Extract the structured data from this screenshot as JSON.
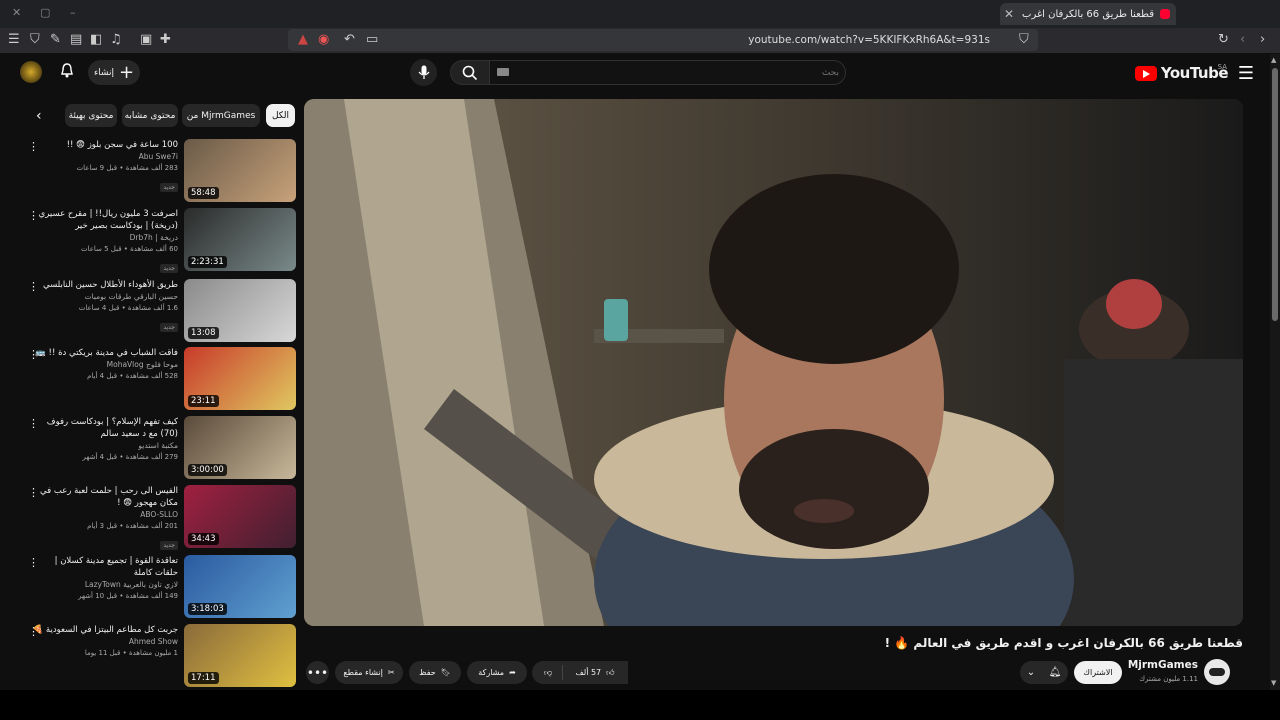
{
  "browser": {
    "tab_title": "قطعنا طريق 66 بالكرفان اغرب و",
    "url": "youtube.com/watch?v=5KKIFKxRh6A&t=931s"
  },
  "header": {
    "logo_text": "YouTube",
    "country_code": "SA",
    "search_placeholder": "بحث",
    "create_label": "إنشاء"
  },
  "chips": {
    "all": "الكل",
    "from": "من MjrmGames",
    "related": "محتوى مشابه",
    "fun": "محتوى بهيئة"
  },
  "video": {
    "title": "قطعنا طريق 66 بالكرفان اغرب و اقدم طريق في العالم 🔥 !",
    "channel": "MjrmGames",
    "subscribers": "1.11 مليون مشترك",
    "subscribe_label": "الاشتراك",
    "likes": "57 ألف",
    "share_label": "مشاركة",
    "save_label": "حفظ",
    "clip_label": "إنشاء مقطع"
  },
  "related": [
    {
      "title": "100 ساعة في سجن بلوز 😨 !!",
      "channel": "Abu Swe7i",
      "meta": "283 ألف مشاهدة • قبل 9 ساعات",
      "badge": "جديد",
      "duration": "58:48",
      "thumb": [
        "#6a5a48",
        "#c8a27a"
      ]
    },
    {
      "title": "اصرفت 3 مليون ريال!! | مقرح عسيري (دريخة) | بودكاست بصير خير",
      "channel": "دريخة | Drb7h",
      "meta": "60 ألف مشاهدة • قبل 5 ساعات",
      "badge": "جديد",
      "duration": "2:23:31",
      "thumb": [
        "#2a2a2a",
        "#7a8a8a"
      ]
    },
    {
      "title": "طريق الأهوداء الأطلال حسين النابلسي",
      "channel": "حسين البارقي طرقات بومبات",
      "meta": "1.6 ألف مشاهدة • قبل 4 ساعات",
      "badge": "جديد",
      "duration": "13:08",
      "thumb": [
        "#8a8a8a",
        "#d8d8d8"
      ]
    },
    {
      "title": "فاقت الشباب في مدينة بريكتي دة !! 🚌",
      "channel": "موحا فلوج MohaVlog",
      "meta": "528 ألف مشاهدة • قبل 4 أيام",
      "badge": "",
      "duration": "23:11",
      "thumb": [
        "#c83a2a",
        "#e0c860"
      ]
    },
    {
      "title": "كيف تفهم الإسلام؟ | بودكاست رفوف (70) مع د سعيد سالم",
      "channel": "مكتبة استديو",
      "meta": "279 ألف مشاهدة • قبل 4 أشهر",
      "badge": "",
      "duration": "3:00:00",
      "thumb": [
        "#5a4a3a",
        "#c8b89a"
      ]
    },
    {
      "title": "الفيس الى رحب | حلمت لعبة رعب في مكان مهجور 😨 !",
      "channel": "ABO-SLLO",
      "meta": "201 ألف مشاهدة • قبل 3 أيام",
      "badge": "جديد",
      "duration": "34:43",
      "thumb": [
        "#a02040",
        "#402030"
      ]
    },
    {
      "title": "تعاقدة القوة | تجميع مدينة كسلان | حلقات كاملة",
      "channel": "لازي تاون بالعربية LazyTown",
      "meta": "149 ألف مشاهدة • قبل 10 أشهر",
      "badge": "",
      "duration": "3:18:03",
      "thumb": [
        "#2a5aa0",
        "#60a0d0"
      ]
    },
    {
      "title": "جربت كل مطاعم البيتزا في السعودية 🍕",
      "channel": "Ahmed Show",
      "meta": "1 مليون مشاهدة • قبل 11 يوما",
      "badge": "",
      "duration": "17:11",
      "thumb": [
        "#8a6a3a",
        "#e0c040"
      ]
    }
  ]
}
